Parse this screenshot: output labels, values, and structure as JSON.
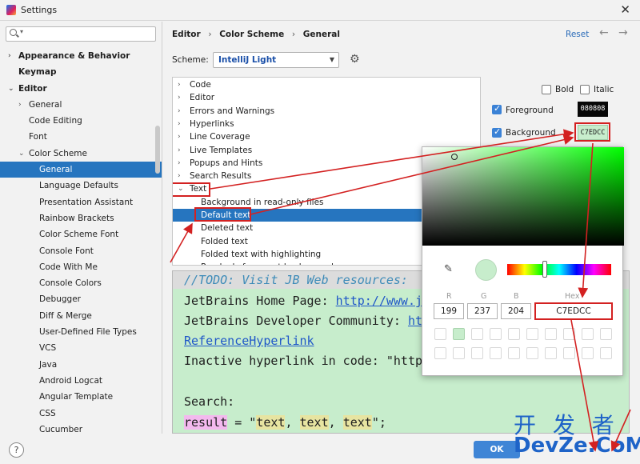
{
  "window": {
    "title": "Settings",
    "close": "✕"
  },
  "search": {
    "placeholder": ""
  },
  "sidebar": {
    "items": [
      {
        "label": "Appearance & Behavior",
        "bold": true,
        "arrow": "›",
        "indent": 0
      },
      {
        "label": "Keymap",
        "bold": true,
        "arrow": "",
        "indent": 0
      },
      {
        "label": "Editor",
        "bold": true,
        "arrow": "⌄",
        "indent": 0
      },
      {
        "label": "General",
        "bold": false,
        "arrow": "›",
        "indent": 1
      },
      {
        "label": "Code Editing",
        "bold": false,
        "arrow": "",
        "indent": 1
      },
      {
        "label": "Font",
        "bold": false,
        "arrow": "",
        "indent": 1
      },
      {
        "label": "Color Scheme",
        "bold": false,
        "arrow": "⌄",
        "indent": 1
      },
      {
        "label": "General",
        "bold": false,
        "arrow": "",
        "indent": 2,
        "selected": true
      },
      {
        "label": "Language Defaults",
        "bold": false,
        "arrow": "",
        "indent": 2
      },
      {
        "label": "Presentation Assistant",
        "bold": false,
        "arrow": "",
        "indent": 2
      },
      {
        "label": "Rainbow Brackets",
        "bold": false,
        "arrow": "",
        "indent": 2
      },
      {
        "label": "Color Scheme Font",
        "bold": false,
        "arrow": "",
        "indent": 2
      },
      {
        "label": "Console Font",
        "bold": false,
        "arrow": "",
        "indent": 2
      },
      {
        "label": "Code With Me",
        "bold": false,
        "arrow": "",
        "indent": 2
      },
      {
        "label": "Console Colors",
        "bold": false,
        "arrow": "",
        "indent": 2
      },
      {
        "label": "Debugger",
        "bold": false,
        "arrow": "",
        "indent": 2
      },
      {
        "label": "Diff & Merge",
        "bold": false,
        "arrow": "",
        "indent": 2
      },
      {
        "label": "User-Defined File Types",
        "bold": false,
        "arrow": "",
        "indent": 2
      },
      {
        "label": "VCS",
        "bold": false,
        "arrow": "",
        "indent": 2
      },
      {
        "label": "Java",
        "bold": false,
        "arrow": "",
        "indent": 2
      },
      {
        "label": "Android Logcat",
        "bold": false,
        "arrow": "",
        "indent": 2
      },
      {
        "label": "Angular Template",
        "bold": false,
        "arrow": "",
        "indent": 2
      },
      {
        "label": "CSS",
        "bold": false,
        "arrow": "",
        "indent": 2
      },
      {
        "label": "Cucumber",
        "bold": false,
        "arrow": "",
        "indent": 2
      }
    ]
  },
  "breadcrumb": {
    "part1": "Editor",
    "part2": "Color Scheme",
    "part3": "General",
    "separator": "›"
  },
  "header": {
    "reset": "Reset",
    "back": "←",
    "forward": "→"
  },
  "scheme": {
    "label": "Scheme:",
    "value": "IntelliJ Light"
  },
  "elements": {
    "rows": [
      {
        "label": "Code",
        "arrow": "›",
        "indent": 0
      },
      {
        "label": "Editor",
        "arrow": "›",
        "indent": 0
      },
      {
        "label": "Errors and Warnings",
        "arrow": "›",
        "indent": 0
      },
      {
        "label": "Hyperlinks",
        "arrow": "›",
        "indent": 0
      },
      {
        "label": "Line Coverage",
        "arrow": "›",
        "indent": 0
      },
      {
        "label": "Live Templates",
        "arrow": "›",
        "indent": 0
      },
      {
        "label": "Popups and Hints",
        "arrow": "›",
        "indent": 0
      },
      {
        "label": "Search Results",
        "arrow": "›",
        "indent": 0
      },
      {
        "label": "Text",
        "arrow": "⌄",
        "indent": 0
      },
      {
        "label": "Background in read-only files",
        "arrow": "",
        "indent": 1
      },
      {
        "label": "Default text",
        "arrow": "",
        "indent": 1,
        "selected": true
      },
      {
        "label": "Deleted text",
        "arrow": "",
        "indent": 1
      },
      {
        "label": "Folded text",
        "arrow": "",
        "indent": 1
      },
      {
        "label": "Folded text with highlighting",
        "arrow": "",
        "indent": 1
      },
      {
        "label": "Readonly fragment background",
        "arrow": "",
        "indent": 1
      }
    ]
  },
  "attributes": {
    "bold": "Bold",
    "italic": "Italic",
    "foreground": {
      "label": "Foreground",
      "hex": "080808",
      "color": "#080808",
      "text_color": "#ffffff",
      "checked": true
    },
    "background": {
      "label": "Background",
      "hex": "C7EDCC",
      "color": "#c7edcc",
      "text_color": "#1e1e1e",
      "checked": true
    }
  },
  "preview": {
    "todo": "//TODO: Visit JB Web resources:",
    "home_label": "JetBrains Home Page: ",
    "home_link": "http://www.j",
    "community_label": "JetBrains Developer Community: ",
    "community_link": "ht",
    "ref_link": "ReferenceHyperlink",
    "inactive": "Inactive hyperlink in code: \"http",
    "search": "Search:",
    "result_var": "result",
    "result_eq": " = \"",
    "result_t1": "text",
    "result_t2": "text",
    "result_t3": "text",
    "result_end": "\";"
  },
  "picker": {
    "r_label": "R",
    "g_label": "G",
    "b_label": "B",
    "hex_label": "Hex",
    "r": "199",
    "g": "237",
    "b": "204",
    "hex": "C7EDCC",
    "color": "#c7edcc"
  },
  "footer": {
    "help": "?",
    "ok": "OK"
  },
  "watermark": {
    "line1": "开 发 者",
    "line2": "DevZe.CoM"
  },
  "colors": {
    "accent": "#2675bf",
    "annotation": "#d32121",
    "link": "#2a6bb8"
  }
}
